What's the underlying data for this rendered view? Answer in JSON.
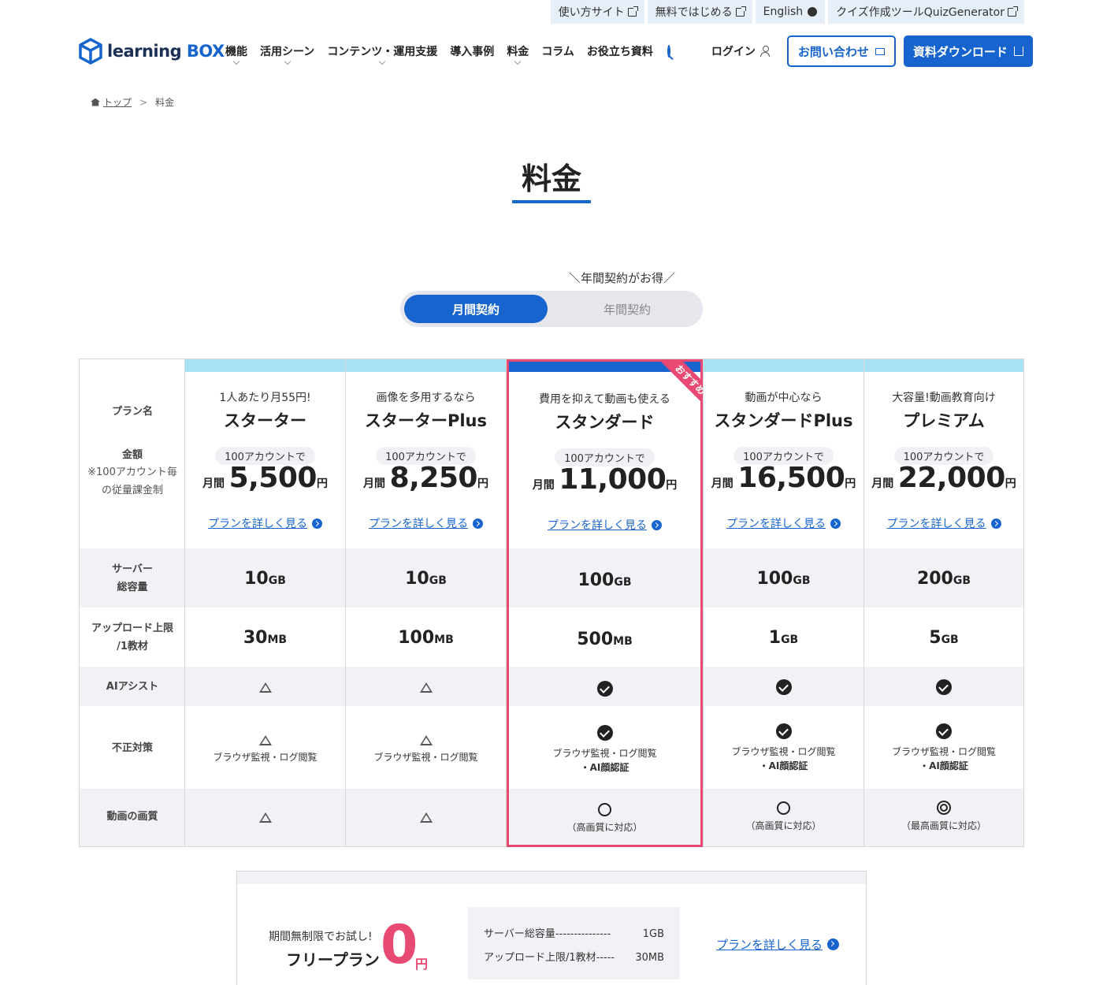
{
  "util_links": [
    {
      "label": "使い方サイト",
      "icon": "external-link-icon"
    },
    {
      "label": "無料ではじめる",
      "icon": "external-link-icon"
    },
    {
      "label": "English",
      "icon": "globe-icon"
    },
    {
      "label": "クイズ作成ツールQuizGenerator",
      "icon": "external-link-icon"
    }
  ],
  "logo": {
    "text_main": "learning",
    "text_accent": "BOX"
  },
  "nav": [
    {
      "label": "機能",
      "has_dropdown": true
    },
    {
      "label": "活用シーン",
      "has_dropdown": true
    },
    {
      "label": "コンテンツ・運用支援",
      "has_dropdown": true
    },
    {
      "label": "導入事例",
      "has_dropdown": false
    },
    {
      "label": "料金",
      "has_dropdown": true
    },
    {
      "label": "コラム",
      "has_dropdown": false
    },
    {
      "label": "お役立ち資料",
      "has_dropdown": false
    }
  ],
  "header": {
    "login_label": "ログイン",
    "contact_label": "お問い合わせ",
    "download_label": "資料ダウンロード"
  },
  "breadcrumb": {
    "home": "トップ",
    "sep": ">",
    "current": "料金"
  },
  "page_title": "料金",
  "billing_toggle": {
    "note": "＼年間契約がお得／",
    "monthly": "月間契約",
    "annual": "年間契約",
    "selected": "monthly"
  },
  "row_labels": {
    "plan_name": "プラン名",
    "price": "金額",
    "price_note_1": "※100アカウント毎",
    "price_note_2": "の従量課金制",
    "server_1": "サーバー",
    "server_2": "総容量",
    "upload_1": "アップロード上限",
    "upload_2": "/1教材",
    "ai": "AIアシスト",
    "fraud": "不正対策",
    "video": "動画の画質"
  },
  "plans": [
    {
      "catch": "1人あたり月55円!",
      "name": "スターター",
      "accounts": "100アカウントで",
      "price_prefix": "月間",
      "price": "5,500",
      "price_unit": "円",
      "link": "プランを詳しく見る",
      "server": "10",
      "server_unit": "GB",
      "upload": "30",
      "upload_unit": "MB",
      "ai": "triangle",
      "fraud": "triangle",
      "fraud_note_1": "ブラウザ監視・ログ閲覧",
      "fraud_note_2": "",
      "video": "triangle",
      "video_note": ""
    },
    {
      "catch": "画像を多用するなら",
      "name": "スターターPlus",
      "accounts": "100アカウントで",
      "price_prefix": "月間",
      "price": "8,250",
      "price_unit": "円",
      "link": "プランを詳しく見る",
      "server": "10",
      "server_unit": "GB",
      "upload": "100",
      "upload_unit": "MB",
      "ai": "triangle",
      "fraud": "triangle",
      "fraud_note_1": "ブラウザ監視・ログ閲覧",
      "fraud_note_2": "",
      "video": "triangle",
      "video_note": ""
    },
    {
      "catch": "費用を抑えて動画も使える",
      "name": "スタンダード",
      "accounts": "100アカウントで",
      "price_prefix": "月間",
      "price": "11,000",
      "price_unit": "円",
      "link": "プランを詳しく見る",
      "server": "100",
      "server_unit": "GB",
      "upload": "500",
      "upload_unit": "MB",
      "ai": "check",
      "fraud": "check",
      "fraud_note_1": "ブラウザ監視・ログ閲覧",
      "fraud_note_2": "・AI顔認証",
      "video": "circle",
      "video_note": "（高画質に対応）",
      "badge": "おすすめ"
    },
    {
      "catch": "動画が中心なら",
      "name": "スタンダードPlus",
      "accounts": "100アカウントで",
      "price_prefix": "月間",
      "price": "16,500",
      "price_unit": "円",
      "link": "プランを詳しく見る",
      "server": "100",
      "server_unit": "GB",
      "upload": "1",
      "upload_unit": "GB",
      "ai": "check",
      "fraud": "check",
      "fraud_note_1": "ブラウザ監視・ログ閲覧",
      "fraud_note_2": "・AI顔認証",
      "video": "circle",
      "video_note": "（高画質に対応）"
    },
    {
      "catch": "大容量!動画教育向け",
      "name": "プレミアム",
      "accounts": "100アカウントで",
      "price_prefix": "月間",
      "price": "22,000",
      "price_unit": "円",
      "link": "プランを詳しく見る",
      "server": "200",
      "server_unit": "GB",
      "upload": "5",
      "upload_unit": "GB",
      "ai": "check",
      "fraud": "check",
      "fraud_note_1": "ブラウザ監視・ログ閲覧",
      "fraud_note_2": "・AI顔認証",
      "video": "double-circle",
      "video_note": "（最高画質に対応）"
    }
  ],
  "free_plan": {
    "catch": "期間無制限でお試し!",
    "name": "フリープラン",
    "price": "0",
    "price_unit": "円",
    "spec_server_label": "サーバー総容量---------------",
    "spec_server_value": "1GB",
    "spec_upload_label": "アップロード上限/1教材-----",
    "spec_upload_value": "30MB",
    "link": "プランを詳しく見る"
  },
  "colors": {
    "brand_blue": "#1764cf",
    "highlight_pink": "#e84a73",
    "column_top": "#a6e1f6",
    "row_shade": "#f1f2f5"
  }
}
